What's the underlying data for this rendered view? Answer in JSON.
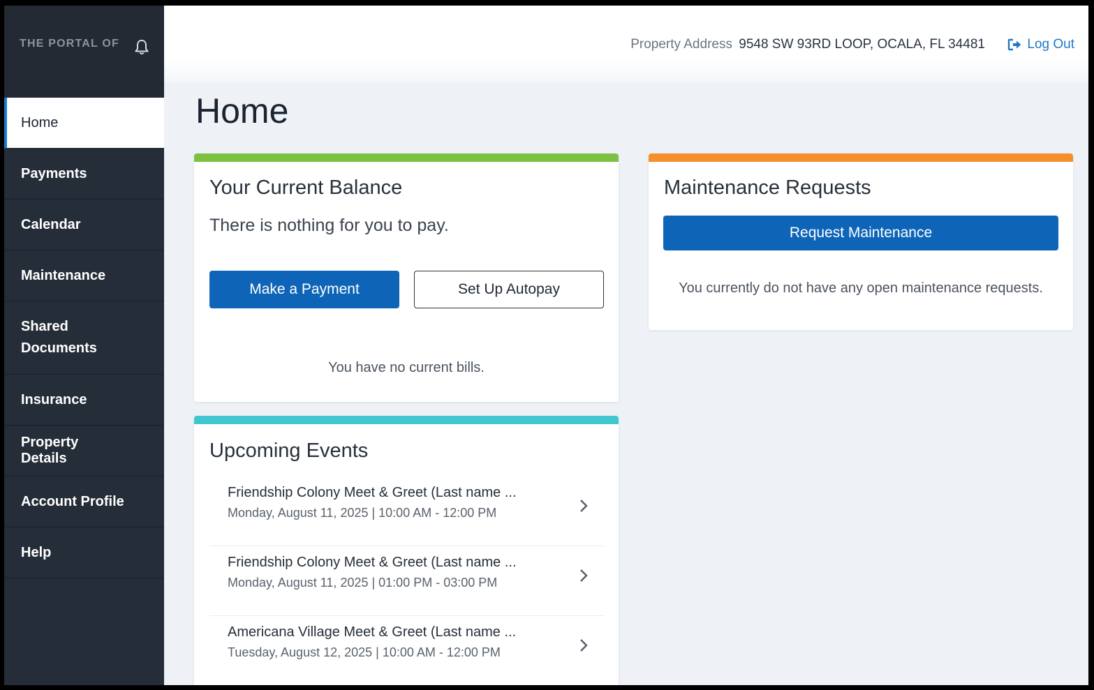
{
  "sidebar": {
    "portal_label": "THE PORTAL OF",
    "items": [
      {
        "label": "Home"
      },
      {
        "label": "Payments"
      },
      {
        "label": "Calendar"
      },
      {
        "label": "Maintenance"
      },
      {
        "label": "Shared Documents"
      },
      {
        "label": "Insurance"
      },
      {
        "label": "Property Details"
      },
      {
        "label": "Account Profile"
      },
      {
        "label": "Help"
      }
    ]
  },
  "header": {
    "address_label": "Property Address",
    "address_value": "9548 SW 93RD LOOP, OCALA, FL 34481",
    "logout_label": "Log Out"
  },
  "page": {
    "title": "Home"
  },
  "balance": {
    "title": "Your Current Balance",
    "message": "There is nothing for you to pay.",
    "pay_label": "Make a Payment",
    "autopay_label": "Set Up Autopay",
    "bills_message": "You have no current bills."
  },
  "events": {
    "title": "Upcoming Events",
    "items": [
      {
        "title": "Friendship Colony Meet & Greet (Last name ...",
        "date": "Monday, August 11, 2025 | 10:00 AM - 12:00 PM"
      },
      {
        "title": "Friendship Colony Meet & Greet (Last name ...",
        "date": "Monday, August 11, 2025 | 01:00 PM - 03:00 PM"
      },
      {
        "title": "Americana Village Meet & Greet (Last name ...",
        "date": "Tuesday, August 12, 2025 | 10:00 AM - 12:00 PM"
      }
    ]
  },
  "maintenance": {
    "title": "Maintenance Requests",
    "button_label": "Request Maintenance",
    "message": "You currently do not have any open maintenance requests."
  },
  "colors": {
    "sidebar": "#252d38",
    "primary": "#0e65b8",
    "balance_accent": "#7dc142",
    "events_accent": "#3fc6cf",
    "maintenance_accent": "#f58f2c",
    "link": "#1f78c9"
  },
  "icons": [
    "bell-icon",
    "logout-icon",
    "chevron-right-icon"
  ]
}
